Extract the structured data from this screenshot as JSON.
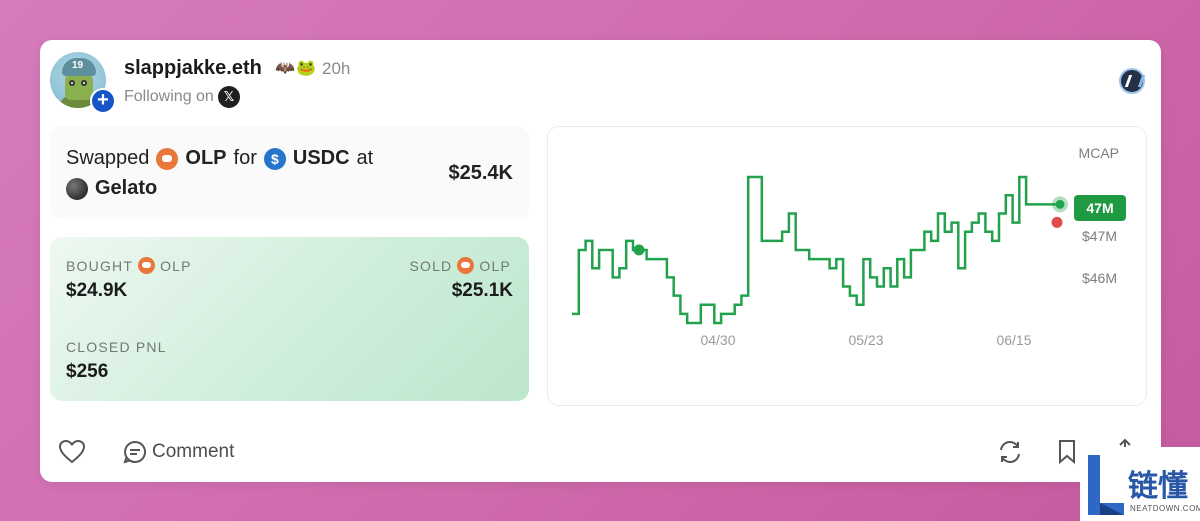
{
  "post": {
    "username": "slappjakke.eth",
    "time": "20h",
    "following_label": "Following on",
    "platform_icon": "x-icon",
    "chain_icon": "arbitrum-icon"
  },
  "swap": {
    "verb": "Swapped",
    "token_in": "OLP",
    "connector": "for",
    "token_out": "USDC",
    "at_label": "at",
    "venue": "Gelato",
    "amount": "$25.4K"
  },
  "pnl": {
    "bought_label": "BOUGHT",
    "bought_token": "OLP",
    "bought_value": "$24.9K",
    "sold_label": "SOLD",
    "sold_token": "OLP",
    "sold_value": "$25.1K",
    "closed_label": "CLOSED PNL",
    "closed_value": "$256"
  },
  "chart_data": {
    "type": "line",
    "title": "MCAP",
    "x_ticks": [
      "04/30",
      "05/23",
      "06/15"
    ],
    "y_ticks": [
      "$47M",
      "$46M"
    ],
    "current_label": "47M",
    "colors": {
      "line": "#23a24d",
      "sell_marker": "#e04b4b",
      "badge": "#1f9a42"
    },
    "series": [
      {
        "values": [
          45.7,
          46.4,
          46.5,
          46.2,
          46.4,
          46.4,
          46.1,
          46.2,
          46.5,
          46.4,
          46.4,
          46.3,
          46.3,
          46.3,
          46.1,
          45.9,
          45.7,
          45.6,
          45.6,
          45.8,
          45.8,
          45.6,
          45.7,
          45.7,
          45.8,
          45.9,
          47.2,
          47.2,
          46.5,
          46.5,
          46.5,
          46.6,
          46.8,
          46.4,
          46.4,
          46.3,
          46.3,
          46.3,
          46.2,
          46.3,
          46.0,
          45.9,
          45.8,
          46.3,
          46.1,
          46.0,
          46.2,
          46.0,
          46.3,
          46.1,
          46.4,
          46.4,
          46.6,
          46.5,
          46.8,
          46.6,
          46.7,
          46.2,
          46.6,
          46.7,
          46.8,
          46.6,
          46.5,
          46.8,
          47.0,
          46.7,
          47.2,
          46.9,
          46.9,
          46.9,
          46.9,
          46.9,
          46.9
        ]
      }
    ],
    "buy_marker_index": 9,
    "sell_marker_index": 72
  },
  "actions": {
    "like_icon": "heart-icon",
    "comment_icon": "comment-icon",
    "comment_label": "Comment",
    "repost_icon": "repost-icon",
    "bookmark_icon": "bookmark-icon",
    "share_icon": "share-icon"
  },
  "watermark": {
    "title": "链懂",
    "subtitle": "NEATDOWN.COM"
  }
}
